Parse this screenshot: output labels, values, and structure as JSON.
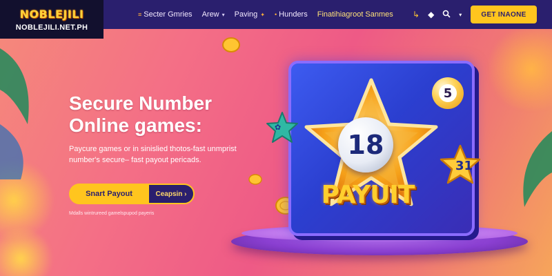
{
  "brand": {
    "logo_text": "NOBLEJILI",
    "site": "NOBLEJILI.NET.PH"
  },
  "nav": {
    "links": [
      {
        "label": "Secter Gmries",
        "chevron": false,
        "spark": true
      },
      {
        "label": "Arew",
        "chevron": true,
        "spark": false
      },
      {
        "label": "Paving",
        "chevron": true,
        "spark": false
      },
      {
        "label": "Hunders",
        "chevron": false,
        "spark": true
      },
      {
        "label": "Finatihiagroot Sanmes",
        "chevron": false,
        "spark": false
      }
    ],
    "icons": [
      "wallet-icon",
      "tag-icon",
      "search-icon",
      "chevron-down-icon"
    ],
    "cta_label": "GET INAONE"
  },
  "hero": {
    "title_line1": "Secure Number",
    "title_line2": "Online games:",
    "description": "Paycure games or in sinislied thotos-fast unmprist number's secure– fast payout pericads.",
    "primary_button": "Snart Payout",
    "secondary_button": "Ceapsin ›",
    "note": "Mdalls wintrureed gamelspupod payeris"
  },
  "illustration": {
    "main_number": "18",
    "ball_number": "5",
    "star_number": "31",
    "badge_text": "PAYUIT"
  },
  "colors": {
    "nav_bg": "#2a1f6e",
    "accent_yellow": "#ffc51e",
    "hero_gradient_start": "#f58a7a",
    "hero_gradient_end": "#f6a55a"
  }
}
